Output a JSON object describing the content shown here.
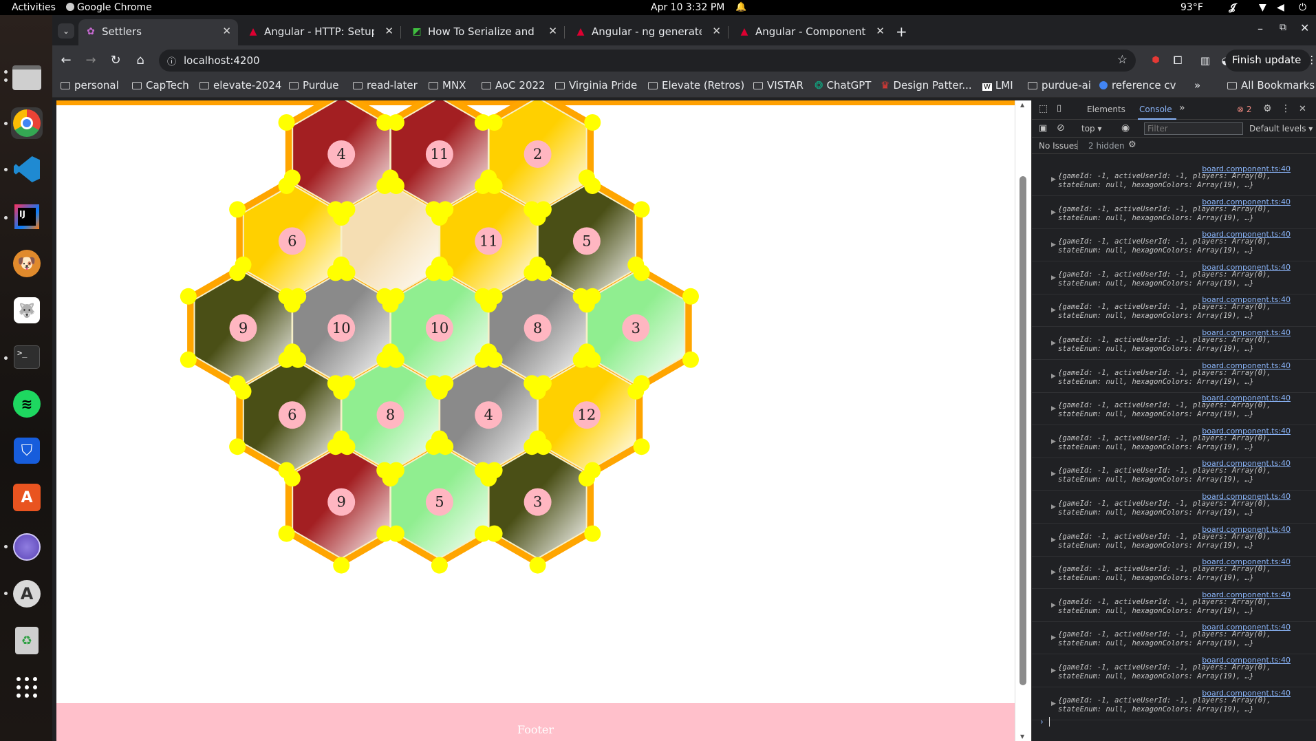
{
  "topbar": {
    "activities": "Activities",
    "app_name": "Google Chrome",
    "clock": "Apr 10  3:32 PM",
    "temperature": "93°F"
  },
  "dock": {
    "apps": [
      "files",
      "chrome",
      "vscode",
      "intellij",
      "dog-app",
      "gimp-like-app",
      "terminal",
      "spotify",
      "bitwarden",
      "app-center",
      "network-app",
      "software-updater",
      "trash",
      "show-apps"
    ]
  },
  "tabs": [
    {
      "title": "Settlers",
      "active": true,
      "icon": "settlers-favicon"
    },
    {
      "title": "Angular - HTTP: Setup fo",
      "active": false,
      "icon": "angular-favicon"
    },
    {
      "title": "How To Serialize and De",
      "active": false,
      "icon": "digitalocean-favicon"
    },
    {
      "title": "Angular - ng generate",
      "active": false,
      "icon": "angular-favicon"
    },
    {
      "title": "Angular - Component in",
      "active": false,
      "icon": "angular-favicon"
    }
  ],
  "address": {
    "url": "localhost:4200"
  },
  "finish_update": "Finish update",
  "bookmarks": [
    {
      "label": "personal",
      "type": "folder"
    },
    {
      "label": "CapTech",
      "type": "folder"
    },
    {
      "label": "elevate-2024",
      "type": "folder"
    },
    {
      "label": "Purdue",
      "type": "folder"
    },
    {
      "label": "read-later",
      "type": "folder"
    },
    {
      "label": "MNX",
      "type": "folder"
    },
    {
      "label": "AoC 2022",
      "type": "folder"
    },
    {
      "label": "Virginia Pride",
      "type": "folder"
    },
    {
      "label": "Elevate (Retros)",
      "type": "folder"
    },
    {
      "label": "VISTAR",
      "type": "folder"
    },
    {
      "label": "ChatGPT",
      "type": "link"
    },
    {
      "label": "Design Patter...",
      "type": "link"
    },
    {
      "label": "LMI",
      "type": "link"
    },
    {
      "label": "purdue-ai",
      "type": "folder"
    },
    {
      "label": "reference cv",
      "type": "link"
    }
  ],
  "all_bookmarks": "All Bookmarks",
  "board": {
    "tiles": [
      {
        "row": 0,
        "col": 0,
        "resource": "brick",
        "number": "4"
      },
      {
        "row": 0,
        "col": 1,
        "resource": "brick",
        "number": "11"
      },
      {
        "row": 0,
        "col": 2,
        "resource": "wheat",
        "number": "2"
      },
      {
        "row": 1,
        "col": 0,
        "resource": "wheat",
        "number": "6"
      },
      {
        "row": 1,
        "col": 1,
        "resource": "desert",
        "number": ""
      },
      {
        "row": 1,
        "col": 2,
        "resource": "wheat",
        "number": "11"
      },
      {
        "row": 1,
        "col": 3,
        "resource": "forest",
        "number": "5"
      },
      {
        "row": 2,
        "col": 0,
        "resource": "forest",
        "number": "9"
      },
      {
        "row": 2,
        "col": 1,
        "resource": "ore",
        "number": "10"
      },
      {
        "row": 2,
        "col": 2,
        "resource": "sheep",
        "number": "10"
      },
      {
        "row": 2,
        "col": 3,
        "resource": "ore",
        "number": "8"
      },
      {
        "row": 2,
        "col": 4,
        "resource": "sheep",
        "number": "3"
      },
      {
        "row": 3,
        "col": 0,
        "resource": "forest",
        "number": "6"
      },
      {
        "row": 3,
        "col": 1,
        "resource": "sheep",
        "number": "8"
      },
      {
        "row": 3,
        "col": 2,
        "resource": "ore",
        "number": "4"
      },
      {
        "row": 3,
        "col": 3,
        "resource": "wheat",
        "number": "12"
      },
      {
        "row": 4,
        "col": 0,
        "resource": "brick",
        "number": "9"
      },
      {
        "row": 4,
        "col": 1,
        "resource": "sheep",
        "number": "5"
      },
      {
        "row": 4,
        "col": 2,
        "resource": "forest",
        "number": "3"
      }
    ],
    "colors": {
      "brick": "#a31f22",
      "wheat": "#ffd000",
      "desert": "#f5deb3",
      "forest": "#4a4f16",
      "ore": "#8a8a8a",
      "sheep": "#90ee90",
      "road": "#ffa500",
      "vertex": "#ffff00",
      "token": "#ffb6c1"
    }
  },
  "footer": "Footer",
  "devtools": {
    "tabs": [
      "Elements",
      "Console"
    ],
    "active_tab": "Console",
    "error_count": "2",
    "context": "top",
    "filter_placeholder": "Filter",
    "levels": "Default levels",
    "no_issues": "No Issues",
    "hidden": "2 hidden",
    "log_source": "board.component.ts:40",
    "log_line1": "{gameId: -1, activeUserId: -1, players: Array(0),",
    "log_line2": "stateEnum: null, hexagonColors: Array(19), …}",
    "log_count": 17
  }
}
